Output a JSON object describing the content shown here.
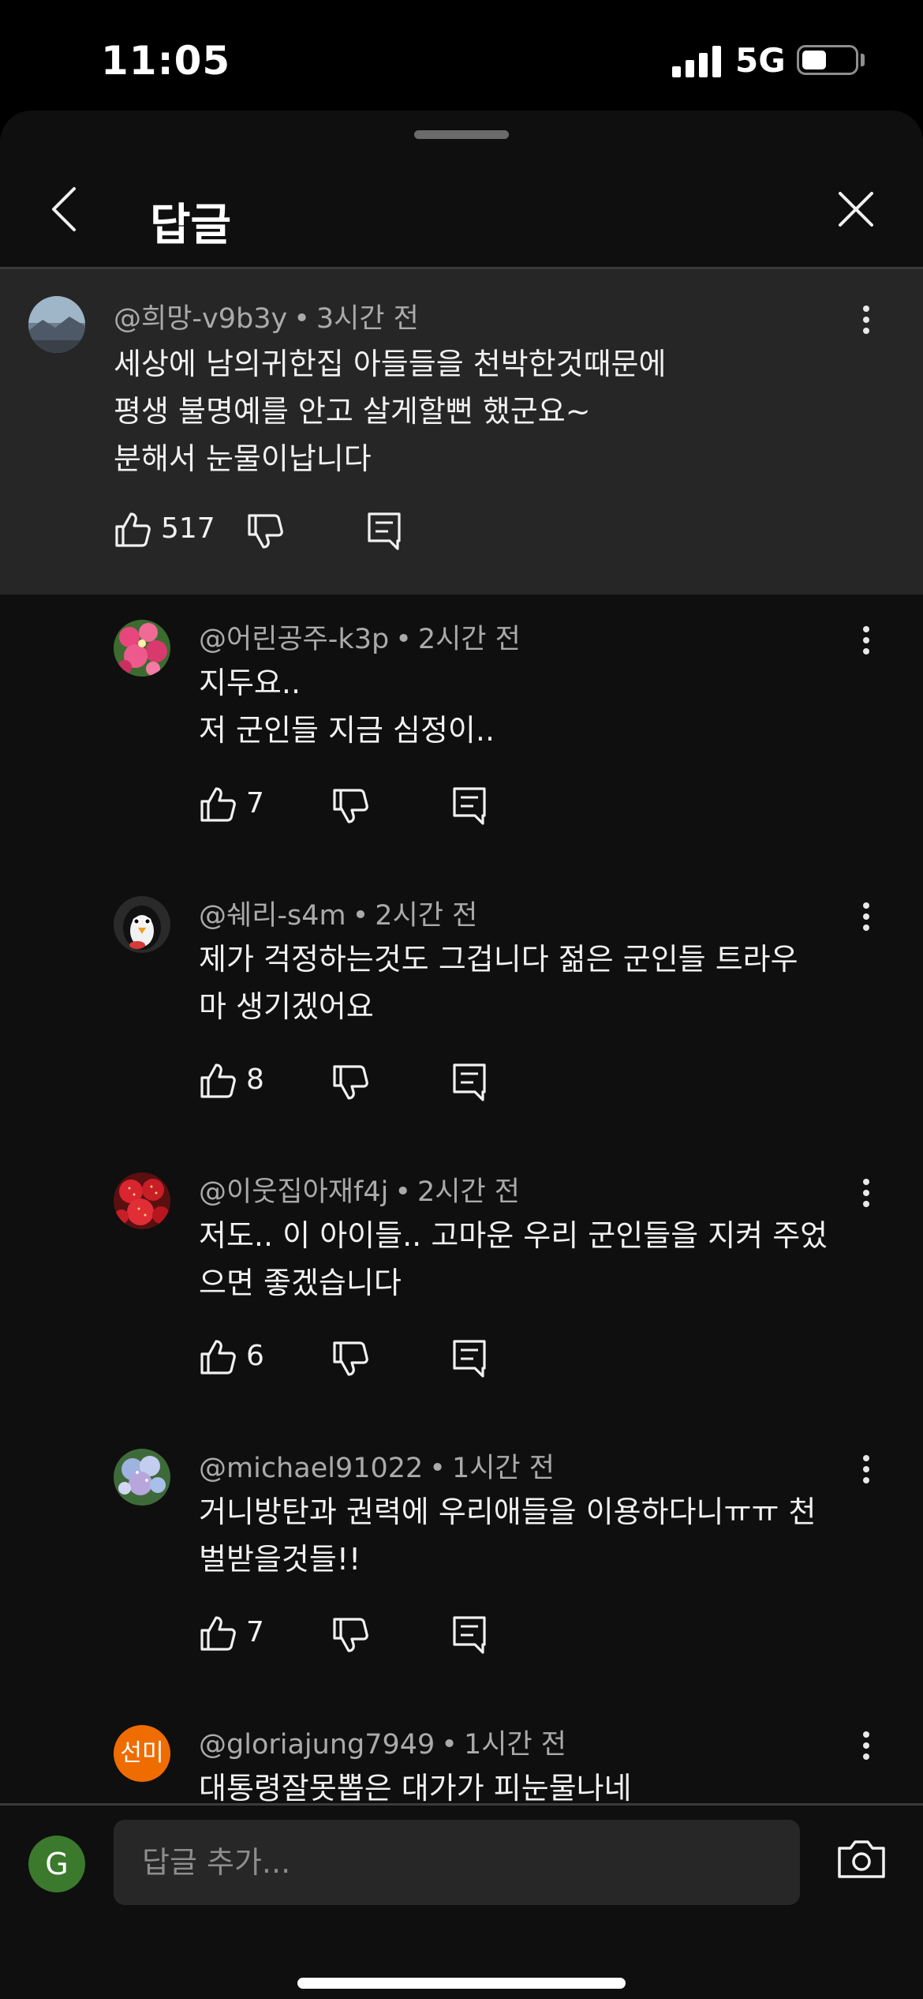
{
  "status": {
    "time": "11:05",
    "network": "5G"
  },
  "sheet": {
    "title": "답글"
  },
  "parent_comment": {
    "author": "@희망-v9b3y",
    "time": "3시간 전",
    "lines": [
      "세상에 남의귀한집 아들들을 천박한것때문에",
      "평생 불명예를 안고 살게할뻔 했군요~",
      "분해서  눈물이납니다"
    ],
    "likes": "517"
  },
  "replies": [
    {
      "author": "@어린공주-k3p",
      "time": "2시간 전",
      "lines": [
        "지두요..",
        "저 군인들 지금 심정이.."
      ],
      "likes": "7",
      "avatar": "pink-flowers"
    },
    {
      "author": "@쉐리-s4m",
      "time": "2시간 전",
      "lines": [
        "제가  걱정하는것도 그겁니다  젊은 군인들  트라우",
        "마  생기겠어요"
      ],
      "likes": "8",
      "avatar": "penguin"
    },
    {
      "author": "@이웃집아재f4j",
      "time": "2시간 전",
      "lines": [
        "저도.. 이 아이들.. 고마운 우리 군인들을 지켜 주었",
        "으면 좋겠습니다"
      ],
      "likes": "6",
      "avatar": "strawberries"
    },
    {
      "author": "@michael91022",
      "time": "1시간 전",
      "lines": [
        "거니방탄과 권력에 우리애들을 이용하다니ㅠㅠ 천",
        "벌받을것들!!"
      ],
      "likes": "7",
      "avatar": "hydrangea"
    },
    {
      "author": "@gloriajung7949",
      "time": "1시간 전",
      "lines": [
        "대통령잘못뽑은 대가가 피눈물나네"
      ],
      "likes": "",
      "avatar_text": "선미",
      "avatar_color": "#ef6c00"
    }
  ],
  "composer": {
    "avatar_letter": "G",
    "placeholder": "답글 추가...",
    "avatar_color": "#3b7a2c"
  }
}
